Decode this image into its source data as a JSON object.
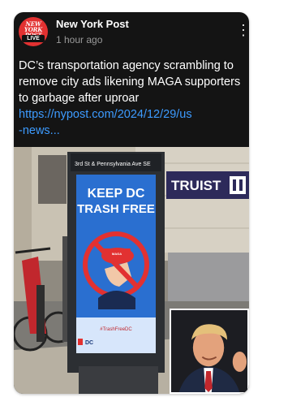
{
  "post": {
    "source_name": "New York Post",
    "timestamp": "1 hour ago",
    "headline": "DC’s transportation agency scrambling to remove city ads likening MAGA supporters to garbage after uproar",
    "link_line1": "https://nypost.com/2024/12/29/us",
    "link_line2": "-news..."
  },
  "avatar": {
    "wordmark_lines": [
      "NEW",
      "YORK",
      "POST"
    ],
    "badge": "LIVE"
  },
  "photo": {
    "street_sign": "3rd St & Pennsylvania Ave SE",
    "poster_line1": "KEEP DC",
    "poster_line2": "TRASH FREE",
    "poster_hashtag": "#TrashFreeDC",
    "poster_logo": "DC",
    "bank_sign": "TRUIST",
    "hat_text": "MAGA"
  },
  "colors": {
    "card_bg": "#141414",
    "link": "#3d9bff",
    "avatar_bg": "#e23131",
    "poster_blue": "#2a6fd0"
  },
  "icons": [
    "more-vertical-icon"
  ]
}
